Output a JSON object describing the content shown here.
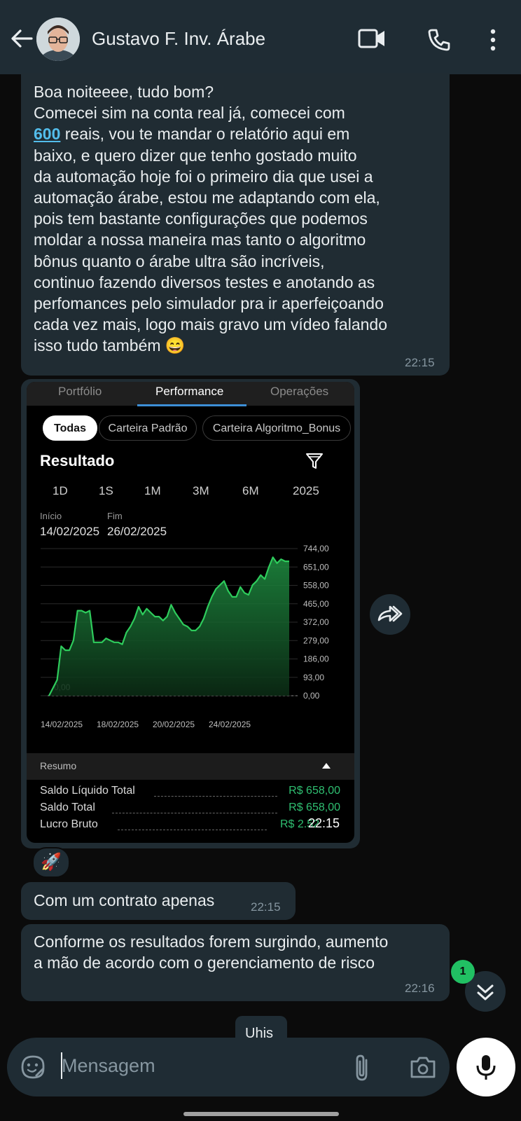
{
  "header": {
    "contact_name": "Gustavo F. Inv. Árabe"
  },
  "messages": [
    {
      "lines": [
        "Boa noiteeee, tudo bom?",
        "Comecei sim na conta real já, comecei com"
      ],
      "link_value": "600",
      "rest_line": " reais, vou te mandar o relatório aqui em",
      "lines2": [
        "baixo, e quero dizer que tenho gostado muito",
        "da automação hoje foi o primeiro dia que usei a",
        "automação árabe, estou me adaptando com ela,",
        "pois tem bastante configurações que podemos",
        "moldar a nossa maneira mas tanto o algoritmo",
        "bônus quanto o árabe ultra são incríveis,",
        "continuo fazendo diversos testes e anotando as",
        "perfomances pelo simulador pra ir aperfeiçoando",
        "cada vez mais, logo mais gravo um vídeo falando",
        "isso tudo também 😄"
      ],
      "time": "22:15"
    },
    {
      "text": "Com um contrato apenas",
      "time": "22:15"
    },
    {
      "text": "Conforme os resultados forem surgindo, aumento\na mão de acordo com o gerenciamento de risco",
      "time": "22:16"
    }
  ],
  "image_message": {
    "time": "22:15",
    "tabs": [
      "Portfólio",
      "Performance",
      "Operações"
    ],
    "active_tab": "Performance",
    "chips": [
      "Todas",
      "Carteira Padrão",
      "Carteira Algoritmo_Bonus"
    ],
    "result_title": "Resultado",
    "ranges": [
      "1D",
      "1S",
      "1M",
      "3M",
      "6M",
      "2025"
    ],
    "start_label": "Início",
    "end_label": "Fim",
    "start_date": "14/02/2025",
    "end_date": "26/02/2025",
    "resumo_label": "Resumo",
    "summary": [
      {
        "label": "Saldo Líquido Total",
        "value": "R$ 658,00"
      },
      {
        "label": "Saldo Total",
        "value": "R$ 658,00"
      },
      {
        "label": "Lucro Bruto",
        "value": "R$ 2.52"
      }
    ]
  },
  "chart_data": {
    "type": "area",
    "y_ticks": [
      "744,00",
      "651,00",
      "558,00",
      "465,00",
      "372,00",
      "279,00",
      "186,00",
      "93,00",
      "0,00"
    ],
    "ylim": [
      0,
      744
    ],
    "x_ticks": [
      "14/02/2025",
      "18/02/2025",
      "20/02/2025",
      "24/02/2025"
    ],
    "baseline_label": "0,00",
    "color": "#2ecc5c",
    "values": [
      0,
      40,
      80,
      250,
      230,
      230,
      280,
      430,
      430,
      420,
      430,
      270,
      270,
      270,
      290,
      280,
      270,
      270,
      260,
      320,
      350,
      390,
      450,
      410,
      440,
      420,
      400,
      400,
      380,
      400,
      460,
      420,
      390,
      360,
      350,
      330,
      330,
      350,
      390,
      450,
      500,
      540,
      560,
      580,
      530,
      500,
      500,
      550,
      520,
      510,
      560,
      580,
      610,
      590,
      650,
      700,
      670,
      690,
      680,
      680
    ]
  },
  "reaction_emoji": "🚀",
  "unread_count": "1",
  "partial_bubble_text": "Uhis",
  "input": {
    "placeholder": "Mensagem"
  },
  "colors": {
    "accent": "#21c063",
    "bubble": "#202c33",
    "header": "#1f2c34",
    "link": "#53bdeb",
    "gain": "#2fbf71"
  }
}
